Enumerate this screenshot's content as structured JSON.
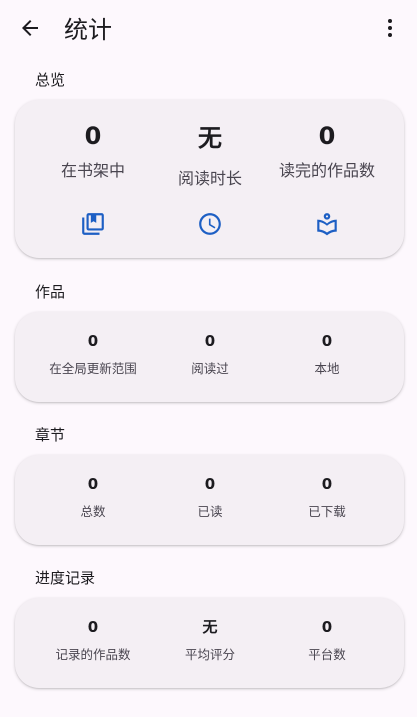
{
  "appbar": {
    "title": "统计",
    "back_icon": "arrow-back-icon",
    "more_icon": "more-vert-icon"
  },
  "overview": {
    "label": "总览",
    "stats": [
      {
        "value": "0",
        "label": "在书架中",
        "icon": "library-icon"
      },
      {
        "value": "无",
        "label": "阅读时长",
        "icon": "clock-icon"
      },
      {
        "value": "0",
        "label": "读完的作品数",
        "icon": "book-read-icon"
      }
    ]
  },
  "works": {
    "label": "作品",
    "stats": [
      {
        "value": "0",
        "label": "在全局更新范围"
      },
      {
        "value": "0",
        "label": "阅读过"
      },
      {
        "value": "0",
        "label": "本地"
      }
    ]
  },
  "chapters": {
    "label": "章节",
    "stats": [
      {
        "value": "0",
        "label": "总数"
      },
      {
        "value": "0",
        "label": "已读"
      },
      {
        "value": "0",
        "label": "已下载"
      }
    ]
  },
  "tracking": {
    "label": "进度记录",
    "stats": [
      {
        "value": "0",
        "label": "记录的作品数"
      },
      {
        "value": "无",
        "label": "平均评分"
      },
      {
        "value": "0",
        "label": "平台数"
      }
    ]
  },
  "colors": {
    "accent": "#1d5fc4",
    "background": "#fdf8fd",
    "card": "#f4eff4"
  }
}
